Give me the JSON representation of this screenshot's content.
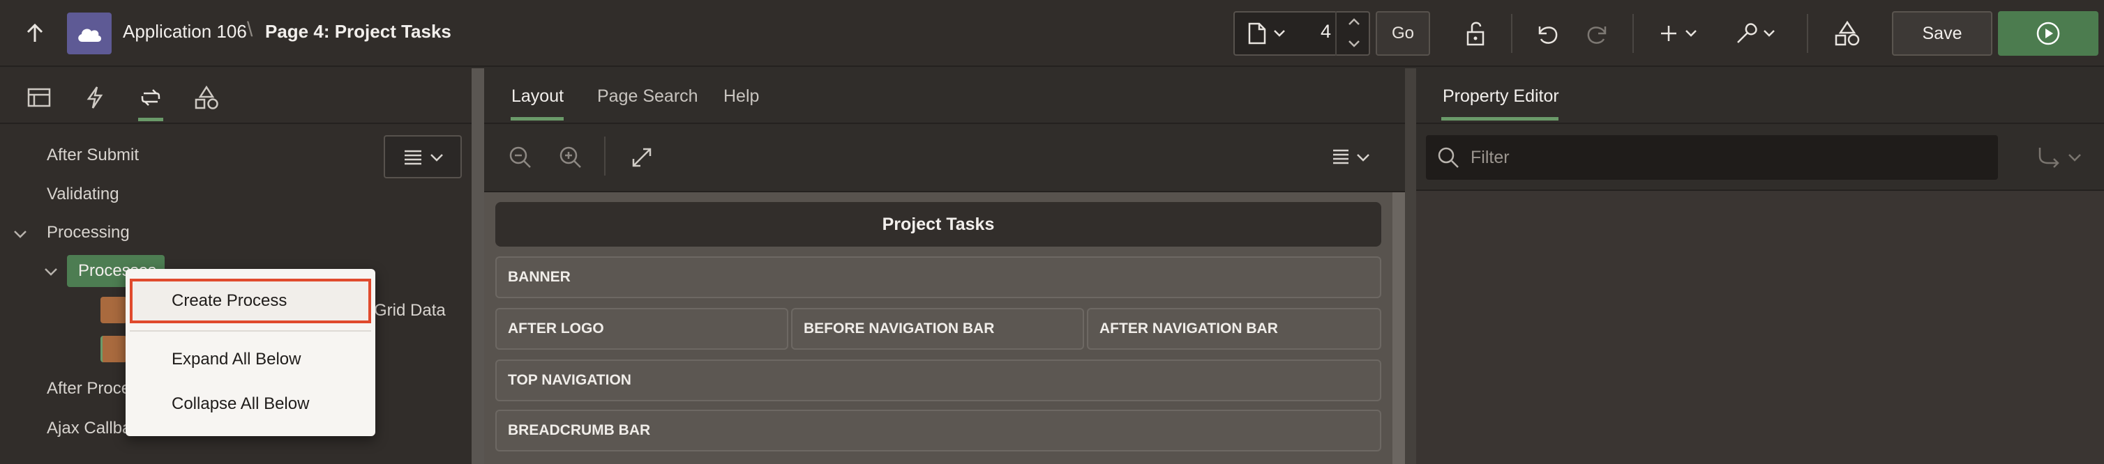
{
  "header": {
    "up_icon": "arrow-up-icon",
    "app_icon": "cloud-icon",
    "app_name": "Application 106",
    "separator": "\\",
    "page_title": "Page 4: Project Tasks",
    "page_number": "4",
    "go_label": "Go",
    "save_label": "Save",
    "icons": [
      "page-icon",
      "chevron-down-icon",
      "lock-icon",
      "undo-icon",
      "redo-icon",
      "plus-icon",
      "wrench-icon",
      "shapes-icon",
      "play-icon"
    ],
    "accent_color": "#4c7c4f"
  },
  "left_panel": {
    "tabs": [
      "rendering-icon",
      "dynamic-actions-icon",
      "processing-icon",
      "shared-components-icon"
    ],
    "tree": {
      "after_submit": "After Submit",
      "validating": "Validating",
      "processing": "Processing",
      "processes": "Processes",
      "grid_data": "Grid Data",
      "after_processing": "After Processing",
      "ajax_callback": "Ajax Callback"
    }
  },
  "context_menu": {
    "items": [
      "Create Process",
      "Expand All Below",
      "Collapse All Below"
    ],
    "focus_color": "#e04a2d"
  },
  "center_panel": {
    "tabs": [
      "Layout",
      "Page Search",
      "Help"
    ],
    "region_title": "Project Tasks",
    "slots": [
      "BANNER",
      "AFTER LOGO",
      "BEFORE NAVIGATION BAR",
      "AFTER NAVIGATION BAR",
      "TOP NAVIGATION",
      "BREADCRUMB BAR"
    ]
  },
  "right_panel": {
    "tab": "Property Editor",
    "filter_placeholder": "Filter"
  }
}
